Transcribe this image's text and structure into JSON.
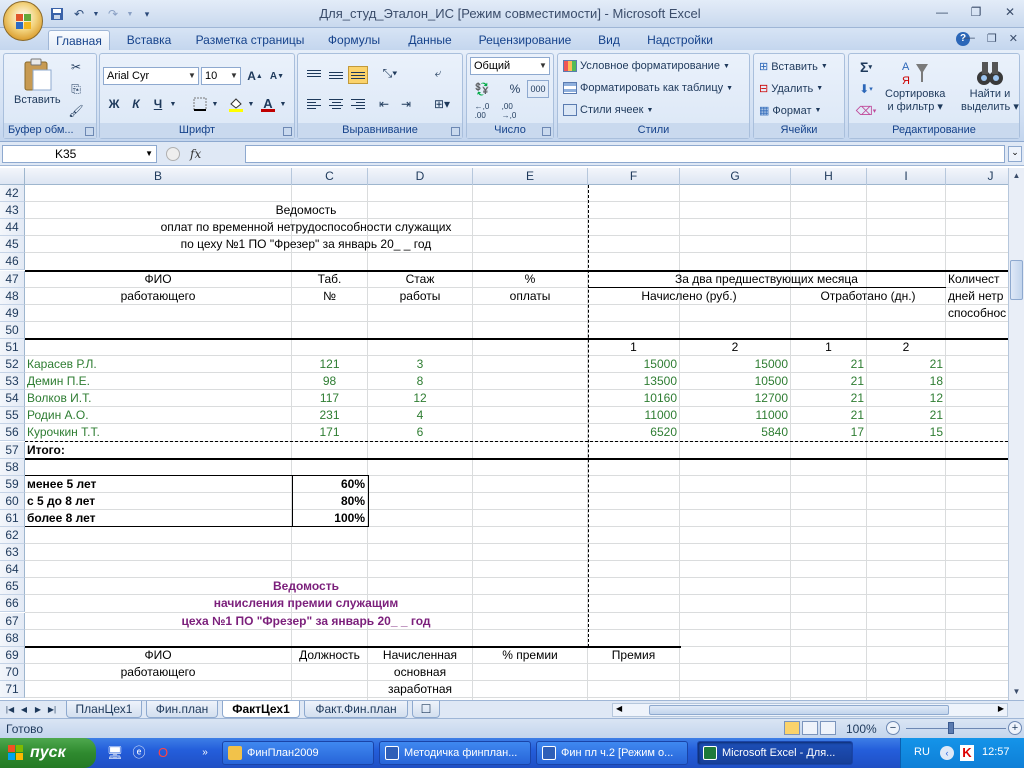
{
  "window": {
    "title": "Для_студ_Эталон_ИС  [Режим совместимости] - Microsoft Excel"
  },
  "ribbon_tabs": [
    "Главная",
    "Вставка",
    "Разметка страницы",
    "Формулы",
    "Данные",
    "Рецензирование",
    "Вид",
    "Надстройки"
  ],
  "ribbon": {
    "clipboard": {
      "paste": "Вставить",
      "title": "Буфер обм..."
    },
    "font": {
      "name": "Arial Cyr",
      "size": "10",
      "bold": "Ж",
      "italic": "К",
      "underline": "Ч",
      "title": "Шрифт"
    },
    "alignment": {
      "title": "Выравнивание"
    },
    "number": {
      "format": "Общий",
      "title": "Число"
    },
    "styles": {
      "conditional": "Условное форматирование",
      "as_table": "Форматировать как таблицу",
      "cell_styles": "Стили ячеек",
      "title": "Стили"
    },
    "cells": {
      "insert": "Вставить",
      "delete": "Удалить",
      "format": "Формат",
      "title": "Ячейки"
    },
    "editing": {
      "sort_1": "Сортировка",
      "sort_2": "и фильтр",
      "find_1": "Найти и",
      "find_2": "выделить",
      "title": "Редактирование"
    }
  },
  "formula_bar": {
    "name_box": "K35",
    "fx": "fx",
    "formula": ""
  },
  "columns": [
    "B",
    "C",
    "D",
    "E",
    "F",
    "G",
    "H",
    "I",
    "J"
  ],
  "rows": [
    "42",
    "43",
    "44",
    "45",
    "46",
    "47",
    "48",
    "49",
    "50",
    "51",
    "52",
    "53",
    "54",
    "55",
    "56",
    "57",
    "58",
    "59",
    "60",
    "61",
    "62",
    "63",
    "64",
    "65",
    "66",
    "67",
    "68",
    "69",
    "70",
    "71"
  ],
  "sheet": {
    "title1": "Ведомость",
    "title2": "оплат по временной нетрудоспособности служащих",
    "title3": "по цеху №1 ПО \"Фрезер\" за январь 20_ _  год",
    "hdr_fio_1": "ФИО",
    "hdr_fio_2": "работающего",
    "hdr_tab_1": "Таб.",
    "hdr_tab_2": "№",
    "hdr_stazh_1": "Стаж",
    "hdr_stazh_2": "работы",
    "hdr_pct_1": "%",
    "hdr_pct_2": "оплаты",
    "hdr_two_months": "За два предшествующих месяца",
    "hdr_accrued": "Начислено (руб.)",
    "hdr_worked": "Отработано (дн.)",
    "hdr_j_1": "Количест",
    "hdr_j_2": "дней нетр",
    "hdr_j_3": "способнос",
    "sub": [
      "1",
      "2",
      "1",
      "2"
    ],
    "employees": [
      {
        "name": "Карасев Р.Л.",
        "tab": "121",
        "stazh": "3",
        "f": "15000",
        "g": "15000",
        "h": "21",
        "i": "21"
      },
      {
        "name": "Демин П.Е.",
        "tab": "98",
        "stazh": "8",
        "f": "13500",
        "g": "10500",
        "h": "21",
        "i": "18"
      },
      {
        "name": "Волков И.Т.",
        "tab": "117",
        "stazh": "12",
        "f": "10160",
        "g": "12700",
        "h": "21",
        "i": "12"
      },
      {
        "name": "Родин А.О.",
        "tab": "231",
        "stazh": "4",
        "f": "11000",
        "g": "11000",
        "h": "21",
        "i": "21"
      },
      {
        "name": "Курочкин Т.Т.",
        "tab": "171",
        "stazh": "6",
        "f": "6520",
        "g": "5840",
        "h": "17",
        "i": "15"
      }
    ],
    "total": "Итого:",
    "rates": [
      {
        "label": "менее 5 лет",
        "value": "60%"
      },
      {
        "label": "с 5 до 8 лет",
        "value": "80%"
      },
      {
        "label": "более 8 лет",
        "value": "100%"
      }
    ],
    "title4": "Ведомость",
    "title5": "начисления премии служащим",
    "title6": "цеха №1 ПО \"Фрезер\" за январь 20_ _  год",
    "h2_fio_1": "ФИО",
    "h2_fio_2": "работающего",
    "h2_position": "Должность",
    "h2_accr_1": "Начисленная",
    "h2_accr_2": "основная",
    "h2_accr_3": "заработная",
    "h2_bonus_pct": "% премии",
    "h2_bonus": "Премия"
  },
  "sheet_tabs": [
    "ПланЦех1",
    "Фин.план",
    "ФактЦех1",
    "Факт.Фин.план"
  ],
  "status": {
    "ready": "Готово",
    "zoom": "100%"
  },
  "taskbar": {
    "start": "пуск",
    "items": [
      "ФинПлан2009",
      "Методичка финплан...",
      "Фин пл ч.2 [Режим о...",
      "Microsoft Excel - Для..."
    ],
    "lang": "RU",
    "clock": "12:57"
  }
}
